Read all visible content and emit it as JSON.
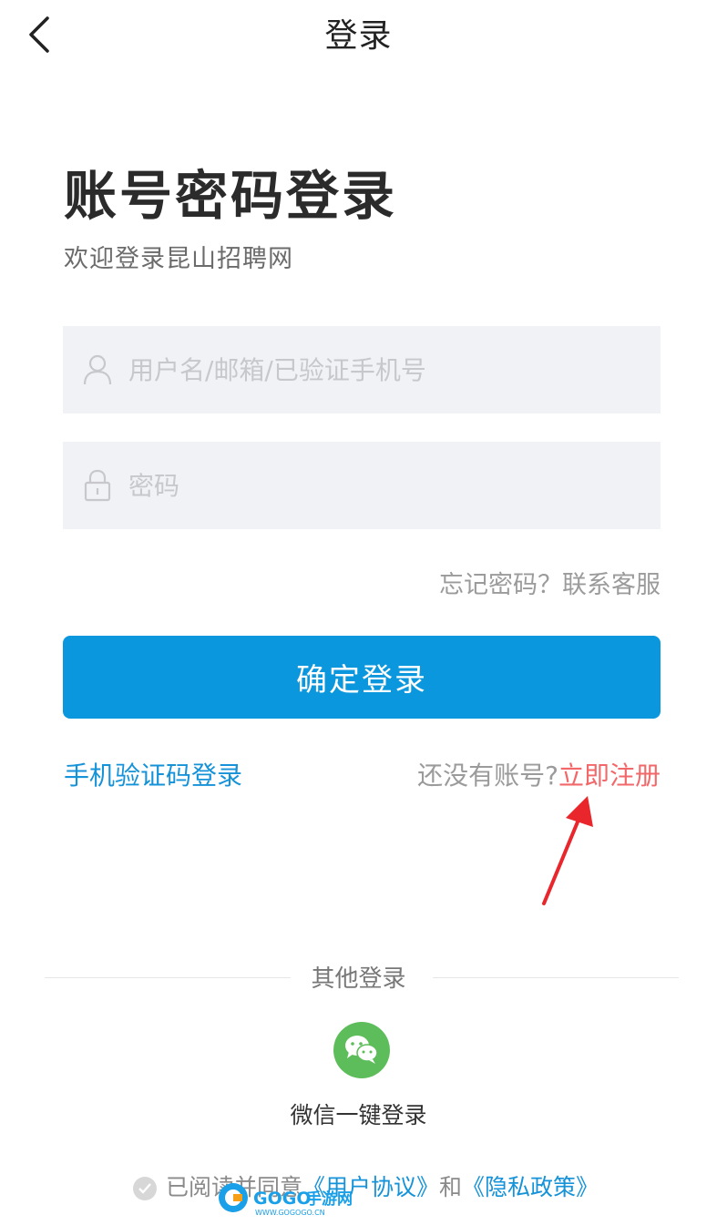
{
  "header": {
    "title": "登录"
  },
  "heading": {
    "title": "账号密码登录",
    "subtitle": "欢迎登录昆山招聘网"
  },
  "form": {
    "username_placeholder": "用户名/邮箱/已验证手机号",
    "password_placeholder": "密码",
    "forgot_text": "忘记密码？联系客服",
    "submit_label": "确定登录"
  },
  "links": {
    "sms_login": "手机验证码登录",
    "no_account": "还没有账号?",
    "register": "立即注册"
  },
  "other_login": {
    "divider_label": "其他登录",
    "wechat_label": "微信一键登录"
  },
  "agreement": {
    "prefix": "已阅读并同意",
    "user_agreement": "《用户协议》",
    "and": "和",
    "privacy_policy": "《隐私政策》"
  },
  "watermark": {
    "logo_text": "GOGO手游网",
    "url_text": "WWW.GOGOGO.CN"
  },
  "colors": {
    "primary": "#0b97dd",
    "link_blue": "#1592d8",
    "register_red": "#f2686a",
    "field_bg": "#f1f2f5",
    "wechat_green": "#5dbd5a",
    "annotation_arrow": "#e8262b"
  },
  "icons": {
    "back": "chevron-left-icon",
    "user": "user-icon",
    "lock": "lock-icon",
    "wechat": "wechat-icon",
    "check": "check-icon"
  }
}
